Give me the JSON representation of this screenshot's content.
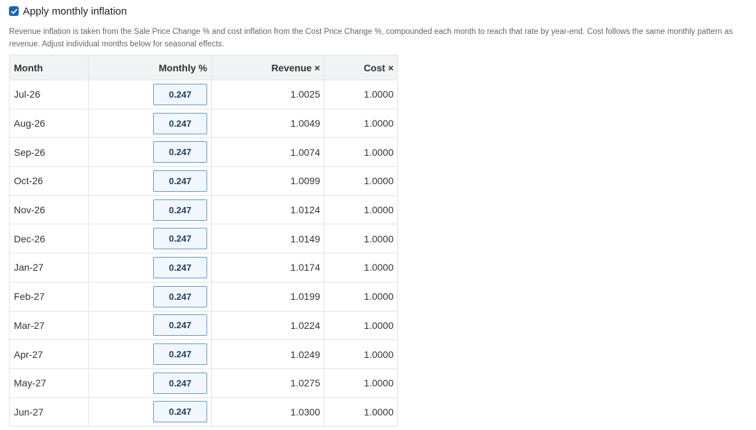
{
  "toggle": {
    "label": "Apply monthly inflation",
    "checked": true
  },
  "description": "Revenue inflation is taken from the Sale Price Change % and cost inflation from the Cost Price Change %, compounded each month to reach that rate by year-end. Cost follows the same monthly pattern as revenue. Adjust individual months below for seasonal effects.",
  "table": {
    "headers": {
      "month": "Month",
      "monthly_pct": "Monthly %",
      "revenue": "Revenue ×",
      "cost": "Cost ×"
    },
    "rows": [
      {
        "month": "Jul-26",
        "monthly_pct": "0.247",
        "revenue": "1.0025",
        "cost": "1.0000"
      },
      {
        "month": "Aug-26",
        "monthly_pct": "0.247",
        "revenue": "1.0049",
        "cost": "1.0000"
      },
      {
        "month": "Sep-26",
        "monthly_pct": "0.247",
        "revenue": "1.0074",
        "cost": "1.0000"
      },
      {
        "month": "Oct-26",
        "monthly_pct": "0.247",
        "revenue": "1.0099",
        "cost": "1.0000"
      },
      {
        "month": "Nov-26",
        "monthly_pct": "0.247",
        "revenue": "1.0124",
        "cost": "1.0000"
      },
      {
        "month": "Dec-26",
        "monthly_pct": "0.247",
        "revenue": "1.0149",
        "cost": "1.0000"
      },
      {
        "month": "Jan-27",
        "monthly_pct": "0.247",
        "revenue": "1.0174",
        "cost": "1.0000"
      },
      {
        "month": "Feb-27",
        "monthly_pct": "0.247",
        "revenue": "1.0199",
        "cost": "1.0000"
      },
      {
        "month": "Mar-27",
        "monthly_pct": "0.247",
        "revenue": "1.0224",
        "cost": "1.0000"
      },
      {
        "month": "Apr-27",
        "monthly_pct": "0.247",
        "revenue": "1.0249",
        "cost": "1.0000"
      },
      {
        "month": "May-27",
        "monthly_pct": "0.247",
        "revenue": "1.0275",
        "cost": "1.0000"
      },
      {
        "month": "Jun-27",
        "monthly_pct": "0.247",
        "revenue": "1.0300",
        "cost": "1.0000"
      }
    ]
  },
  "colors": {
    "accent": "#1565c0",
    "input_border": "#5b9bd5",
    "input_bg": "#f1f7fd",
    "header_bg": "#f2f3f5"
  }
}
